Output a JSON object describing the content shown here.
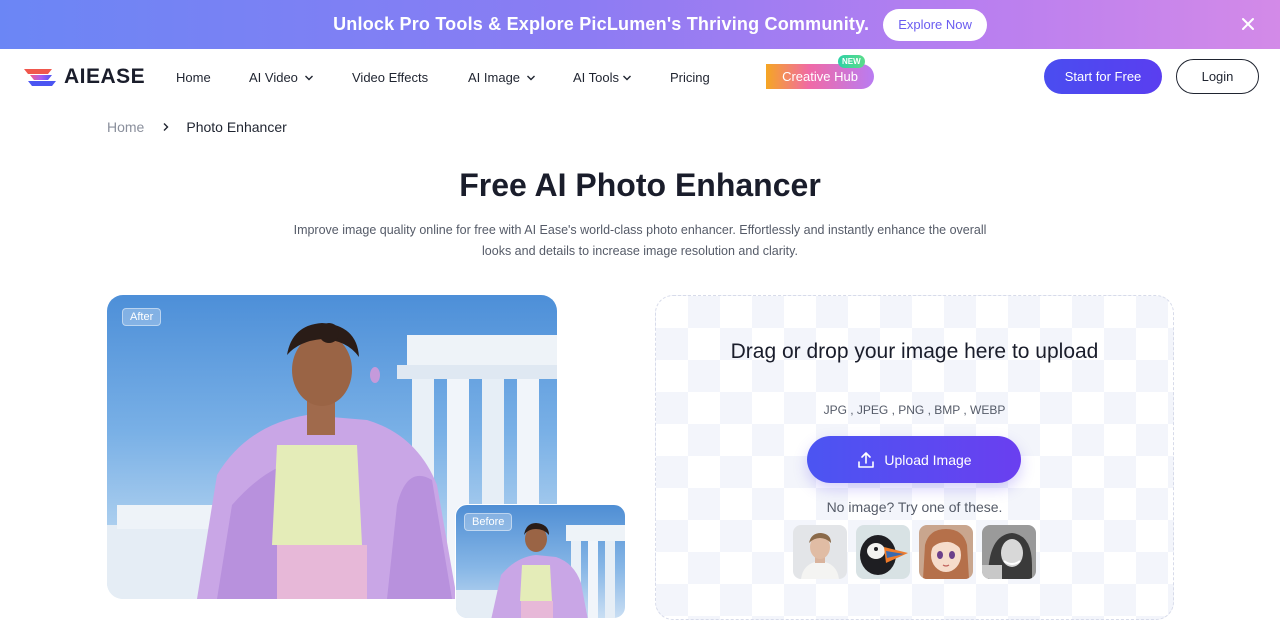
{
  "promo": {
    "text": "Unlock Pro Tools & Explore PicLumen's Thriving Community.",
    "button": "Explore Now"
  },
  "nav": {
    "logo": "AIEASE",
    "items": [
      {
        "label": "Home"
      },
      {
        "label": "AI Video"
      },
      {
        "label": "Video Effects"
      },
      {
        "label": "AI Image"
      },
      {
        "label": "AI Tools"
      },
      {
        "label": "Pricing"
      }
    ],
    "creative_hub": "Creative Hub",
    "new_badge": "NEW",
    "start_button": "Start for Free",
    "login_button": "Login"
  },
  "breadcrumb": {
    "home": "Home",
    "current": "Photo Enhancer"
  },
  "hero": {
    "title": "Free AI Photo Enhancer",
    "subtitle": "Improve image quality online for free with AI Ease's world-class photo enhancer. Effortlessly and instantly enhance the overall looks and details to increase image resolution and clarity."
  },
  "demo": {
    "after_label": "After",
    "before_label": "Before"
  },
  "upload": {
    "drop_text": "Drag or drop your image here to upload",
    "formats": "JPG , JPEG , PNG , BMP , WEBP",
    "button": "Upload Image",
    "sample_prompt": "No image? Try one of these."
  },
  "colors": {
    "accent": "#4b55f2",
    "text": "#1f2430",
    "muted": "#555b68"
  }
}
